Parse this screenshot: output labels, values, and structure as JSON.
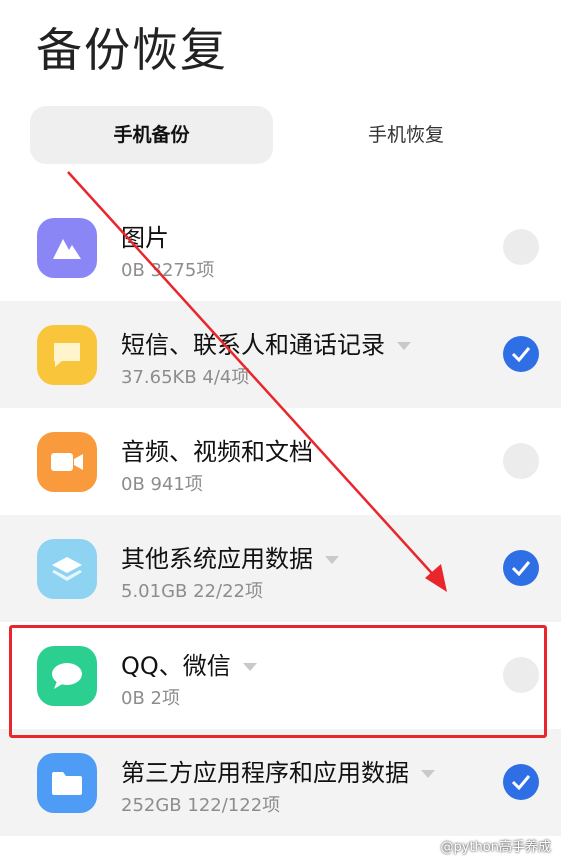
{
  "page": {
    "title": "备份恢复"
  },
  "tabs": [
    {
      "label": "手机备份",
      "active": true
    },
    {
      "label": "手机恢复",
      "active": false
    }
  ],
  "items": [
    {
      "title": "图片",
      "subtitle": "0B  3275项",
      "checked": false,
      "has_dropdown": false,
      "icon": "mountain-icon",
      "icon_color": "#8b86f5"
    },
    {
      "title": "短信、联系人和通话记录",
      "subtitle": "37.65KB  4/4项",
      "checked": true,
      "has_dropdown": true,
      "icon": "message-card-icon",
      "icon_color": "#f9c53a"
    },
    {
      "title": "音频、视频和文档",
      "subtitle": "0B  941项",
      "checked": false,
      "has_dropdown": false,
      "icon": "video-camera-icon",
      "icon_color": "#f99a3c"
    },
    {
      "title": "其他系统应用数据",
      "subtitle": "5.01GB  22/22项",
      "checked": true,
      "has_dropdown": true,
      "icon": "layers-icon",
      "icon_color": "#8fd3f3"
    },
    {
      "title": "QQ、微信",
      "subtitle": "0B  2项",
      "checked": false,
      "has_dropdown": true,
      "icon": "chat-bubble-icon",
      "icon_color": "#2bcf8f"
    },
    {
      "title": "第三方应用程序和应用数据",
      "subtitle": "252GB  122/122项",
      "checked": true,
      "has_dropdown": true,
      "icon": "folder-icon",
      "icon_color": "#4f9cf6"
    }
  ],
  "annotation": {
    "color": "#e8262b"
  },
  "watermark": {
    "text": "@python高手养成"
  },
  "colors": {
    "accent": "#2f6fe6",
    "selected_row_bg": "#f3f3f3"
  }
}
